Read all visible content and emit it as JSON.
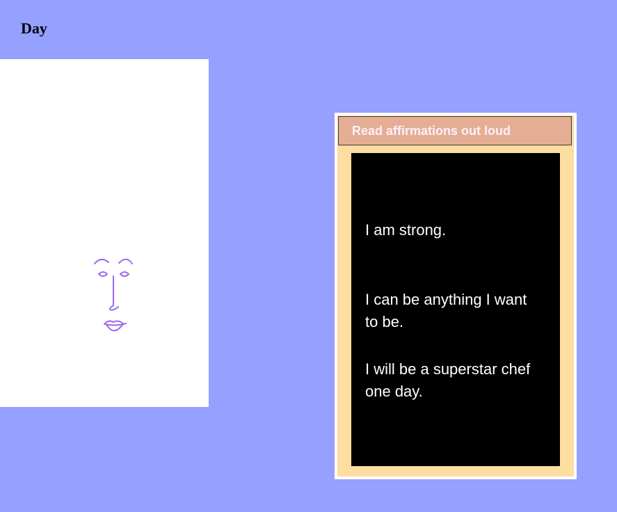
{
  "page": {
    "title": "Day"
  },
  "portrait": {
    "face_color": "#9a68f0",
    "icon": "face-line-drawing-icon"
  },
  "affirmations": {
    "header": "Read affirmations out loud",
    "items": [
      "I am strong.",
      "I can be anything I want to be.",
      "I will be a superstar chef one day."
    ]
  },
  "colors": {
    "background": "#96a0fe",
    "header_bg": "#e4ae94",
    "header_text": "#fdeefb",
    "frame_fill": "#fedda0",
    "board": "#000000"
  }
}
